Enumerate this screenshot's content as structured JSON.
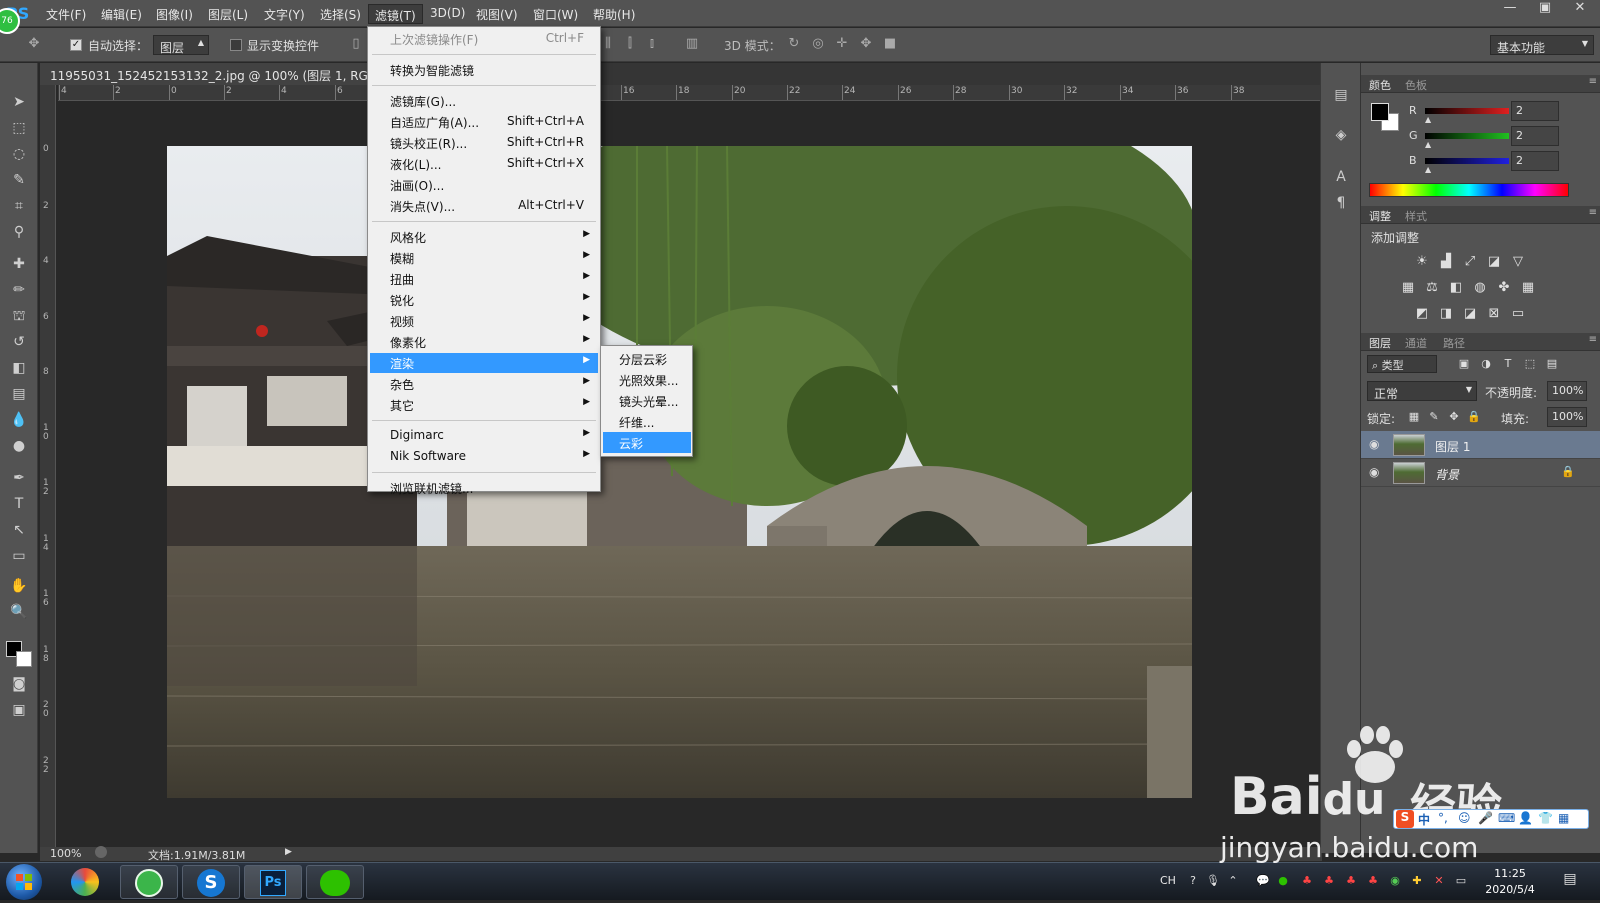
{
  "app": {
    "logo": "PS",
    "badge": "76",
    "window_buttons": [
      "—",
      "▣",
      "✕"
    ]
  },
  "menubar": {
    "items": [
      "文件(F)",
      "编辑(E)",
      "图像(I)",
      "图层(L)",
      "文字(Y)",
      "选择(S)",
      "滤镜(T)",
      "3D(D)",
      "视图(V)",
      "窗口(W)",
      "帮助(H)"
    ],
    "active_index": 6
  },
  "options": {
    "auto_select_label": "自动选择：",
    "auto_select_checked": true,
    "auto_select_value": "图层",
    "show_transform_label": "显示变换控件",
    "show_transform_checked": false,
    "mode_3d_label": "3D 模式：",
    "workspace": "基本功能"
  },
  "document": {
    "tab_title": "11955031_152452153132_2.jpg @ 100% (图层 1, RGB/8#)",
    "zoom": "100%",
    "doc_info": "文档:1.91M/3.81M"
  },
  "ruler": {
    "h_ticks": [
      "4",
      "2",
      "0",
      "2",
      "4",
      "6",
      "16",
      "18",
      "20",
      "22",
      "24",
      "26",
      "28",
      "30",
      "32",
      "34",
      "36",
      "38"
    ],
    "v_ticks": [
      "0",
      "2",
      "4",
      "6",
      "8",
      "1\n0",
      "1\n2",
      "1\n4",
      "1\n6",
      "1\n8",
      "2\n0",
      "2\n2"
    ]
  },
  "filter_menu": {
    "groups": [
      [
        {
          "label": "上次滤镜操作(F)",
          "shortcut": "Ctrl+F",
          "disabled": true
        }
      ],
      [
        {
          "label": "转换为智能滤镜",
          "shortcut": ""
        }
      ],
      [
        {
          "label": "滤镜库(G)...",
          "shortcut": ""
        },
        {
          "label": "自适应广角(A)...",
          "shortcut": "Shift+Ctrl+A"
        },
        {
          "label": "镜头校正(R)...",
          "shortcut": "Shift+Ctrl+R"
        },
        {
          "label": "液化(L)...",
          "shortcut": "Shift+Ctrl+X"
        },
        {
          "label": "油画(O)...",
          "shortcut": ""
        },
        {
          "label": "消失点(V)...",
          "shortcut": "Alt+Ctrl+V"
        }
      ],
      [
        {
          "label": "风格化",
          "submenu": true
        },
        {
          "label": "模糊",
          "submenu": true
        },
        {
          "label": "扭曲",
          "submenu": true
        },
        {
          "label": "锐化",
          "submenu": true
        },
        {
          "label": "视频",
          "submenu": true
        },
        {
          "label": "像素化",
          "submenu": true
        },
        {
          "label": "渲染",
          "submenu": true,
          "highlighted": true
        },
        {
          "label": "杂色",
          "submenu": true
        },
        {
          "label": "其它",
          "submenu": true
        }
      ],
      [
        {
          "label": "Digimarc",
          "submenu": true
        },
        {
          "label": "Nik Software",
          "submenu": true
        }
      ],
      [
        {
          "label": "浏览联机滤镜...",
          "shortcut": ""
        }
      ]
    ]
  },
  "render_submenu": {
    "items": [
      "分层云彩",
      "光照效果...",
      "镜头光晕...",
      "纤维...",
      "云彩"
    ],
    "highlighted_index": 4
  },
  "color_panel": {
    "tabs": [
      "颜色",
      "色板"
    ],
    "channels": [
      {
        "label": "R",
        "value": "2",
        "color": "#e02020"
      },
      {
        "label": "G",
        "value": "2",
        "color": "#20c020"
      },
      {
        "label": "B",
        "value": "2",
        "color": "#2020e0"
      }
    ]
  },
  "adjust_panel": {
    "tabs": [
      "调整",
      "样式"
    ],
    "title": "添加调整"
  },
  "layers_panel": {
    "tabs": [
      "图层",
      "通道",
      "路径"
    ],
    "filter_kind": "类型",
    "blend_mode": "正常",
    "opacity_label": "不透明度:",
    "opacity": "100%",
    "lock_label": "锁定:",
    "fill_label": "填充:",
    "fill": "100%",
    "layers": [
      {
        "name": "图层 1",
        "selected": true,
        "locked": false
      },
      {
        "name": "背景",
        "selected": false,
        "locked": true
      }
    ]
  },
  "taskbar": {
    "lang": "CH",
    "time": "11:25",
    "date": "2020/5/4",
    "ps_label": "Ps"
  },
  "watermark": {
    "brand": "Bai",
    "brand_du": "du",
    "jingyan": "经验",
    "url": "jingyan.baidu.com",
    "ime": "中",
    "ime_s": "S"
  },
  "colors": {
    "highlight": "#3399ff",
    "ps_blue": "#31a8ff",
    "panel_bg": "#535353"
  }
}
